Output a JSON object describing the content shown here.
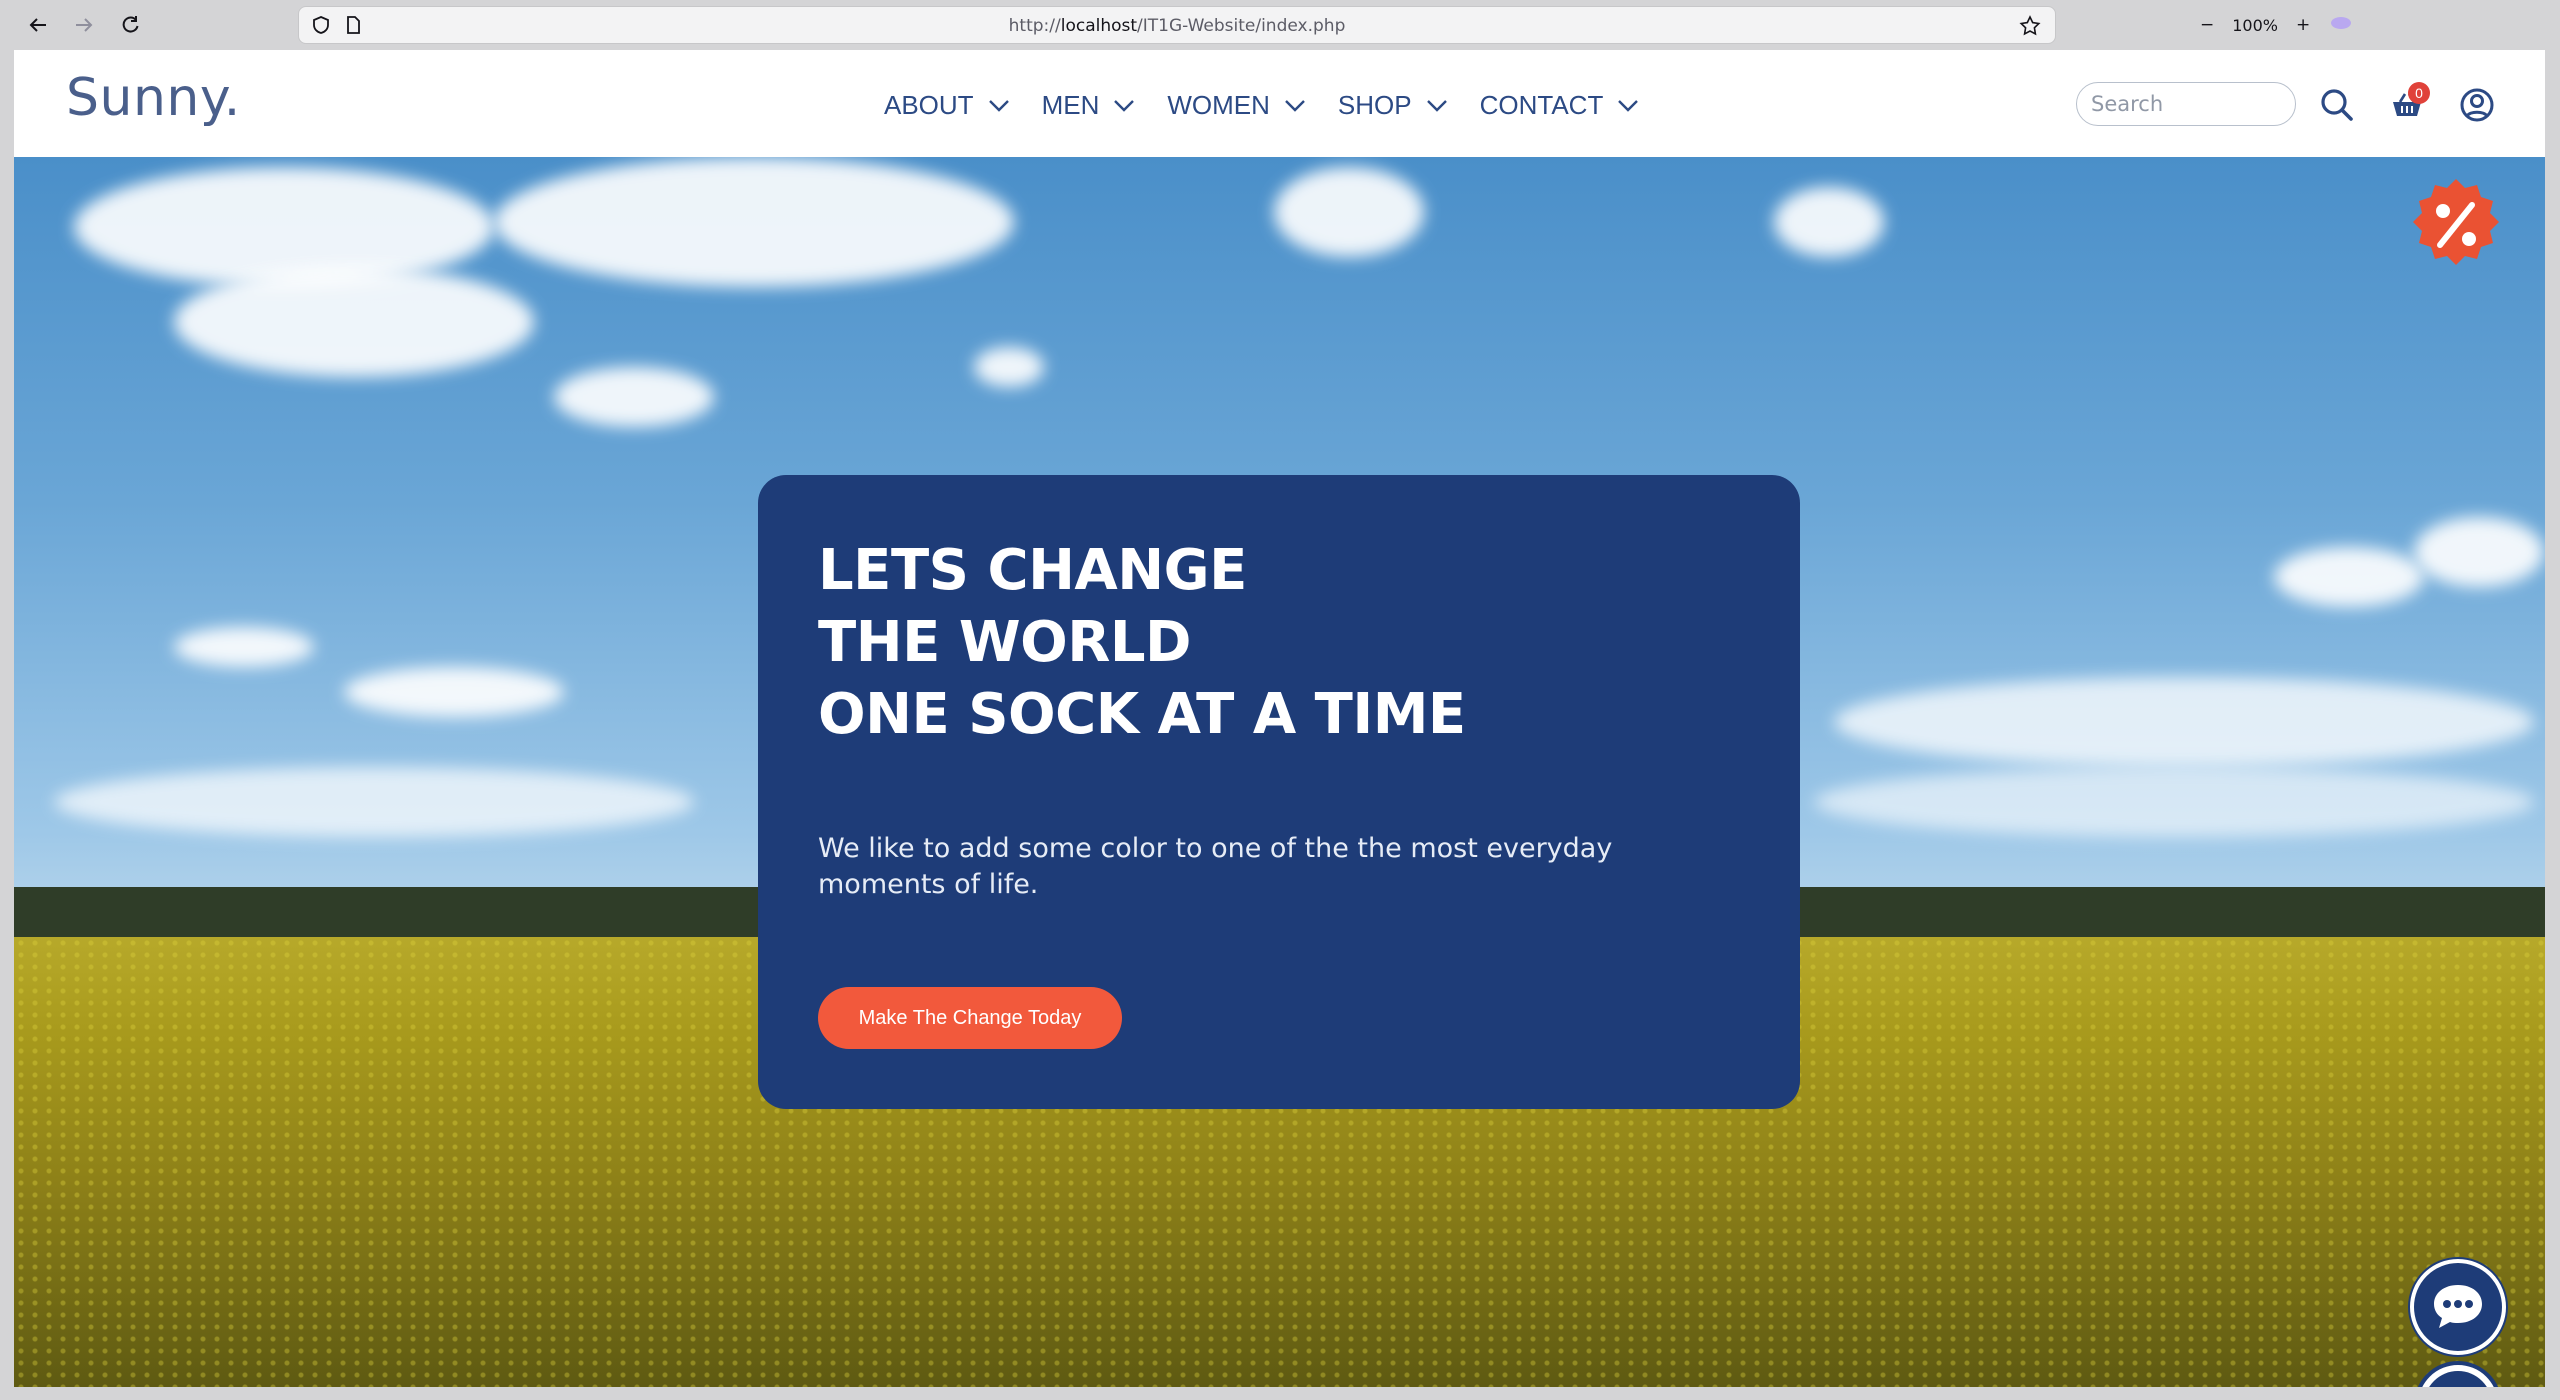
{
  "browser": {
    "url_prefix": "http://",
    "url_host": "localhost",
    "url_path": "/IT1G-Website/index.php",
    "zoom": "100%",
    "zoom_out": "−",
    "zoom_in": "+"
  },
  "site": {
    "logo": "Sunny.",
    "nav": [
      {
        "label": "ABOUT"
      },
      {
        "label": "MEN"
      },
      {
        "label": "WOMEN"
      },
      {
        "label": "SHOP"
      },
      {
        "label": "CONTACT"
      }
    ],
    "search_placeholder": "Search",
    "cart_count": "0"
  },
  "hero": {
    "line1": "LETS CHANGE",
    "line2": "THE WORLD",
    "line3": "ONE SOCK AT A TIME",
    "text": "We like to add some color to one of the the most everyday moments of life.",
    "button": "Make The Change Today"
  },
  "colors": {
    "brand_navy": "#1e3c78",
    "accent_orange": "#f2593c",
    "nav_text": "#2c4a84"
  }
}
